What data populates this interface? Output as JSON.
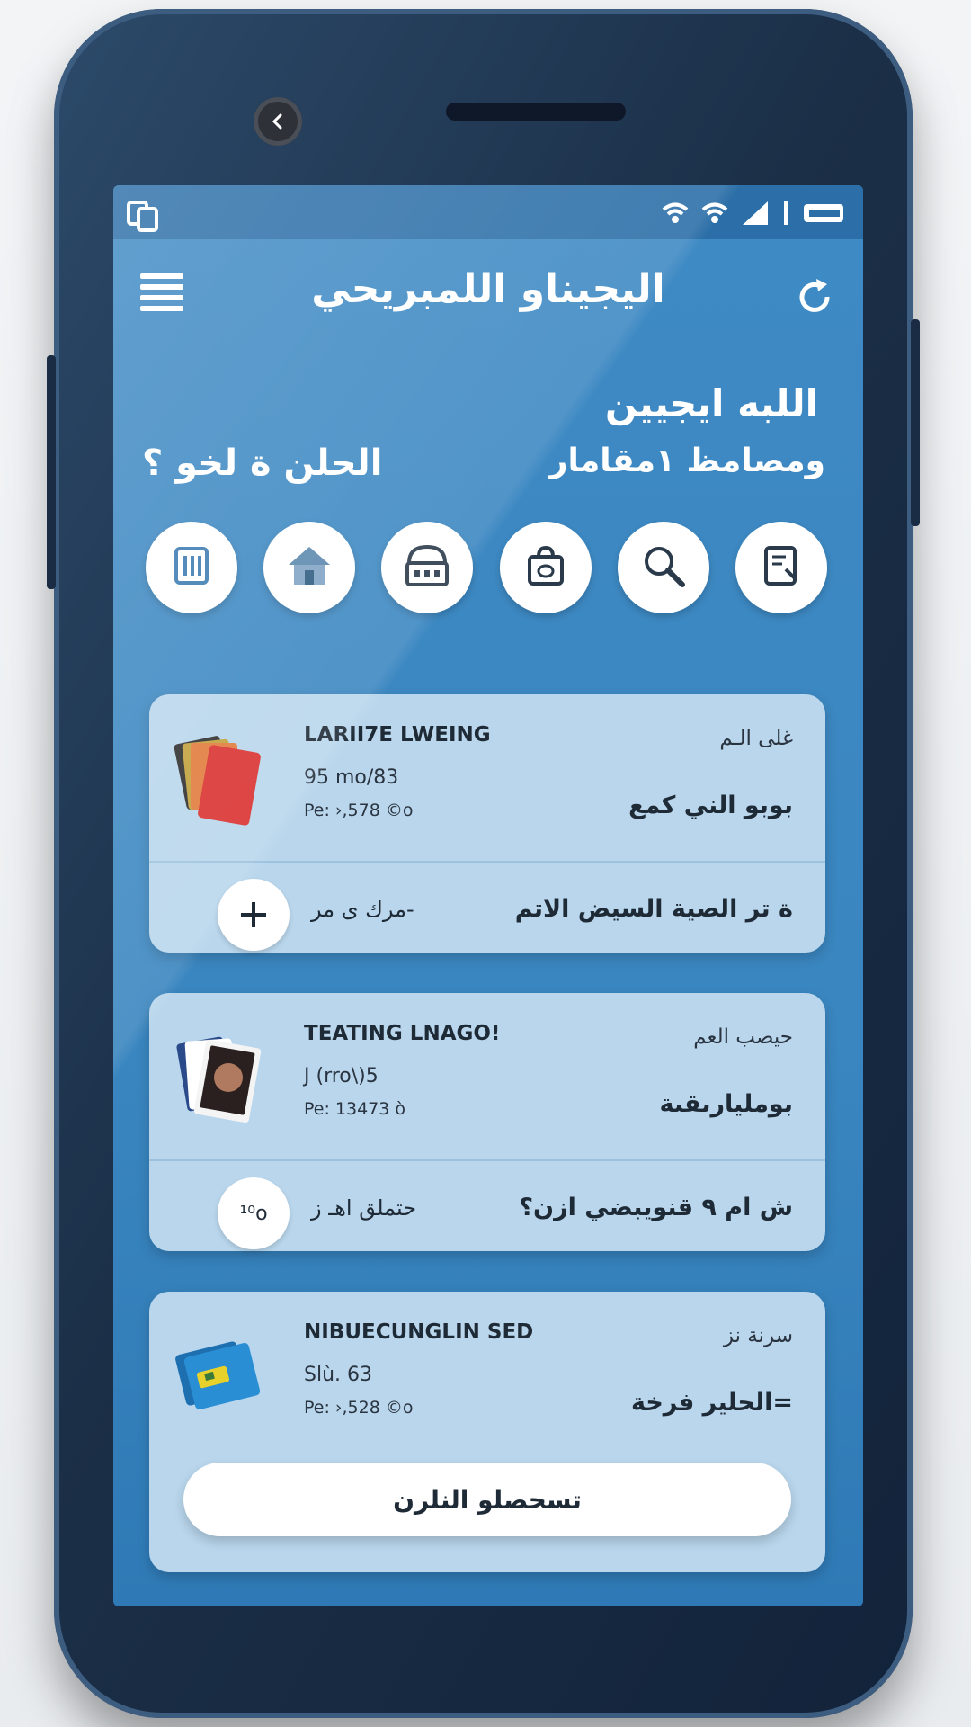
{
  "colors": {
    "screen_bg": "#3a86c0",
    "card_bg": "#b9d6ec",
    "phone_body": "#1b2f47",
    "text_dark": "#1e2a36",
    "text_light": "#ffffff"
  },
  "statusbar": {
    "left_icon": "copy-icon",
    "right_icons": [
      "wifi-icon",
      "wifi-icon",
      "signal-icon",
      "battery-icon"
    ]
  },
  "appbar": {
    "title": "اليجيناو اللمبريحي",
    "menu_icon": "hamburger-menu-icon",
    "action_icon": "refresh-icon"
  },
  "hero": {
    "title": "اللبه ايجيين",
    "subtitle": "ومصامظ ١مقامار",
    "left_text": "الحلن ة لخو ؟"
  },
  "categories": [
    {
      "icon": "notebook-icon"
    },
    {
      "icon": "home-icon"
    },
    {
      "icon": "store-icon"
    },
    {
      "icon": "bag-icon"
    },
    {
      "icon": "search-icon"
    },
    {
      "icon": "document-icon"
    }
  ],
  "items": [
    {
      "name": "LARII7E LWEING",
      "meta1": "95 mo/83",
      "meta2": "Pe: ›,578 ©o",
      "ar_top": "غلى الـم",
      "ar_main": "بوبو الني كمع",
      "bottom_mid": "مرك ى مر-",
      "bottom_right": "ة تر الصية السيض الاتم",
      "button_label": "+",
      "thumb_icon": "red-cards-icon"
    },
    {
      "name": "TEATING LNAGO!",
      "meta1": "J (rro\\)5",
      "meta2": "Pe: 13473 ò",
      "ar_top": "حيصب العم",
      "ar_main": "بومليارىقىة",
      "bottom_mid": "حتملق اهـ ز",
      "bottom_right": "ش ام ٩ قنويبضي ازن؟",
      "button_label": "¹⁰o",
      "thumb_icon": "photo-cards-icon"
    },
    {
      "name": "NIBUECUNGLIN SED",
      "meta1": "Slù. 63",
      "meta2": "Pe: ›,528 ©o",
      "ar_top": "سرنة نز",
      "ar_main": "الحلير فرخة=",
      "cta_label": "تسحصلو النلرن",
      "thumb_icon": "blue-cards-icon"
    }
  ]
}
